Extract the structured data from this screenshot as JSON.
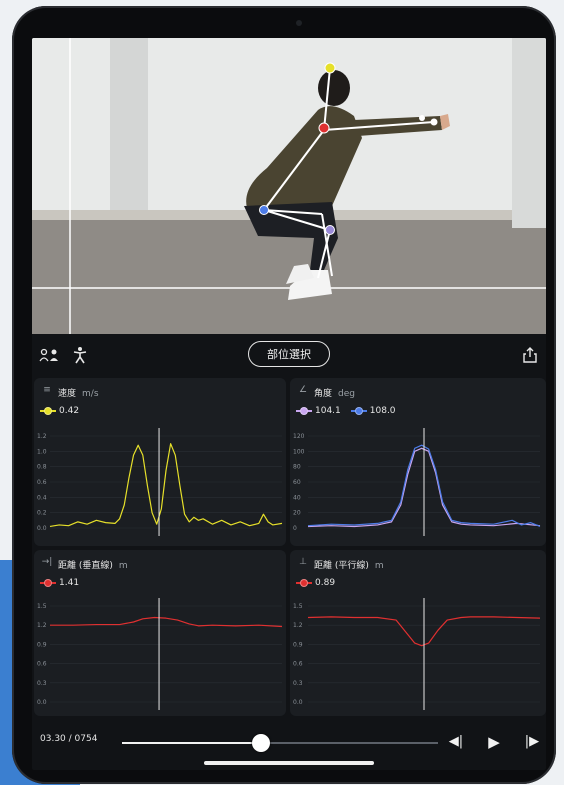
{
  "toolbar": {
    "part_select_label": "部位選択"
  },
  "panels": {
    "speed": {
      "title": "速度",
      "unit": "m/s",
      "legend": [
        {
          "value": "0.42",
          "color": "#e6e02a"
        }
      ]
    },
    "angle": {
      "title": "角度",
      "unit": "deg",
      "legend": [
        {
          "value": "104.1",
          "color": "#c9a6f0"
        },
        {
          "value": "108.0",
          "color": "#4d7ce8"
        }
      ]
    },
    "dist_v": {
      "title": "距離 (垂直線)",
      "unit": "m",
      "legend": [
        {
          "value": "1.41",
          "color": "#e03030"
        }
      ]
    },
    "dist_h": {
      "title": "距離 (平行線)",
      "unit": "m",
      "legend": [
        {
          "value": "0.89",
          "color": "#e03030"
        }
      ]
    }
  },
  "chart_data": [
    {
      "type": "line",
      "title": "速度",
      "ylabel": "m/s",
      "yticks": [
        "1.2",
        "1.0",
        "0.8",
        "0.6",
        "0.4",
        "0.2",
        "0.0"
      ],
      "ylim": [
        0,
        1.2
      ],
      "cursor_x": 0.47,
      "series": [
        {
          "name": "0.42",
          "color": "#e6e02a",
          "x": [
            0,
            0.04,
            0.08,
            0.12,
            0.16,
            0.2,
            0.24,
            0.28,
            0.3,
            0.32,
            0.34,
            0.36,
            0.38,
            0.4,
            0.42,
            0.44,
            0.46,
            0.48,
            0.5,
            0.52,
            0.54,
            0.56,
            0.58,
            0.6,
            0.62,
            0.64,
            0.66,
            0.7,
            0.74,
            0.78,
            0.82,
            0.86,
            0.9,
            0.92,
            0.94,
            0.96,
            1.0
          ],
          "y": [
            0.02,
            0.04,
            0.03,
            0.08,
            0.05,
            0.1,
            0.07,
            0.06,
            0.12,
            0.3,
            0.65,
            0.95,
            1.08,
            0.95,
            0.55,
            0.2,
            0.05,
            0.25,
            0.75,
            1.1,
            0.95,
            0.55,
            0.18,
            0.08,
            0.14,
            0.1,
            0.12,
            0.05,
            0.1,
            0.04,
            0.08,
            0.03,
            0.06,
            0.18,
            0.08,
            0.04,
            0.06
          ]
        }
      ]
    },
    {
      "type": "line",
      "title": "角度",
      "ylabel": "deg",
      "yticks": [
        "120",
        "100",
        "80",
        "60",
        "40",
        "20",
        "0"
      ],
      "ylim": [
        0,
        120
      ],
      "cursor_x": 0.5,
      "series": [
        {
          "name": "104.1",
          "color": "#c9a6f0",
          "x": [
            0,
            0.1,
            0.2,
            0.3,
            0.36,
            0.4,
            0.43,
            0.46,
            0.49,
            0.52,
            0.55,
            0.58,
            0.62,
            0.66,
            0.7,
            0.8,
            0.9,
            1.0
          ],
          "y": [
            2,
            3,
            2,
            4,
            8,
            30,
            70,
            100,
            104,
            100,
            72,
            30,
            8,
            5,
            4,
            3,
            6,
            3
          ]
        },
        {
          "name": "108.0",
          "color": "#4d7ce8",
          "x": [
            0,
            0.1,
            0.2,
            0.3,
            0.36,
            0.4,
            0.43,
            0.46,
            0.49,
            0.52,
            0.55,
            0.58,
            0.62,
            0.66,
            0.7,
            0.8,
            0.88,
            0.92,
            0.96,
            1.0
          ],
          "y": [
            3,
            5,
            4,
            6,
            10,
            34,
            76,
            104,
            108,
            103,
            76,
            34,
            10,
            7,
            6,
            5,
            10,
            4,
            7,
            2
          ]
        }
      ]
    },
    {
      "type": "line",
      "title": "距離 (垂直線)",
      "ylabel": "m",
      "yticks": [
        "1.5",
        "1.2",
        "0.9",
        "0.6",
        "0.3",
        "0.0"
      ],
      "ylim": [
        0,
        1.5
      ],
      "cursor_x": 0.47,
      "series": [
        {
          "name": "1.41",
          "color": "#e03030",
          "x": [
            0,
            0.1,
            0.2,
            0.3,
            0.36,
            0.4,
            0.45,
            0.5,
            0.55,
            0.6,
            0.64,
            0.7,
            0.8,
            0.9,
            1.0
          ],
          "y": [
            1.2,
            1.2,
            1.21,
            1.21,
            1.25,
            1.3,
            1.32,
            1.31,
            1.28,
            1.22,
            1.19,
            1.2,
            1.19,
            1.2,
            1.18
          ]
        }
      ]
    },
    {
      "type": "line",
      "title": "距離 (平行線)",
      "ylabel": "m",
      "yticks": [
        "1.5",
        "1.2",
        "0.9",
        "0.6",
        "0.3",
        "0.0"
      ],
      "ylim": [
        0,
        1.5
      ],
      "cursor_x": 0.5,
      "series": [
        {
          "name": "0.89",
          "color": "#e03030",
          "x": [
            0,
            0.1,
            0.2,
            0.3,
            0.38,
            0.42,
            0.46,
            0.49,
            0.52,
            0.56,
            0.6,
            0.66,
            0.7,
            0.8,
            0.9,
            1.0
          ],
          "y": [
            1.32,
            1.33,
            1.32,
            1.32,
            1.28,
            1.1,
            0.92,
            0.88,
            0.92,
            1.12,
            1.28,
            1.32,
            1.33,
            1.33,
            1.32,
            1.31
          ]
        }
      ]
    }
  ],
  "player": {
    "time": "03.30 / 0754",
    "progress": 0.44
  }
}
